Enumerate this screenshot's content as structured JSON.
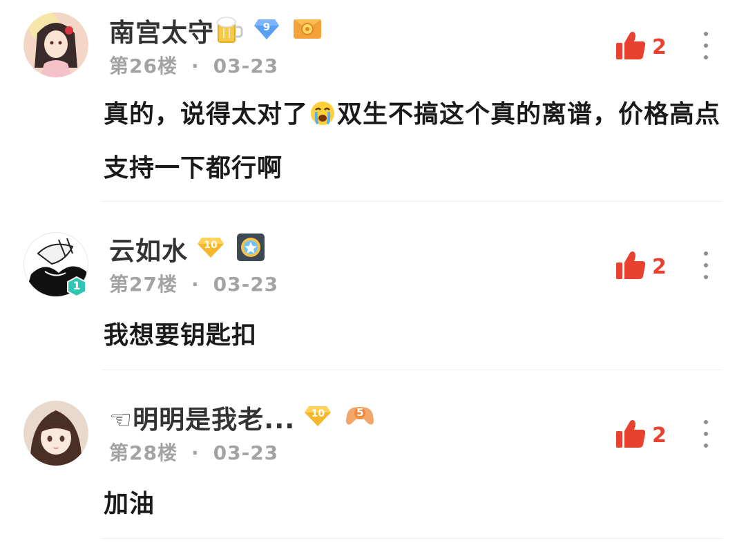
{
  "comments": [
    {
      "username": "南宫太守",
      "floor": "第26楼",
      "separator": "·",
      "date": "03-23",
      "likes": "2",
      "level_badge": "9",
      "content_before_emoji": "真的，说得太对了",
      "content_after_emoji": "双生不搞这个真的离谱，价格高点支持一下都行啊",
      "icons": [
        "beer-icon",
        "blue-diamond-level-icon",
        "gold-medal-icon",
        "crying-emoji-icon",
        "thumbs-up-icon",
        "more-dots-icon"
      ]
    },
    {
      "username": "云如水",
      "floor": "第27楼",
      "separator": "·",
      "date": "03-23",
      "likes": "2",
      "level_badge": "10",
      "avatar_level": "1",
      "content": "我想要钥匙扣",
      "icons": [
        "gold-diamond-level-icon",
        "star-medal-icon",
        "thumbs-up-icon",
        "more-dots-icon"
      ]
    },
    {
      "username": "☜明明是我老...",
      "floor": "第28楼",
      "separator": "·",
      "date": "03-23",
      "likes": "2",
      "level_badge": "10",
      "gamepad_level": "5",
      "content": "加油",
      "icons": [
        "gold-diamond-level-icon",
        "gamepad-badge-icon",
        "thumbs-up-icon",
        "more-dots-icon"
      ]
    }
  ],
  "colors": {
    "like_red": "#e8412f",
    "meta_gray": "#a3a3a3",
    "text": "#1a1a1a"
  }
}
